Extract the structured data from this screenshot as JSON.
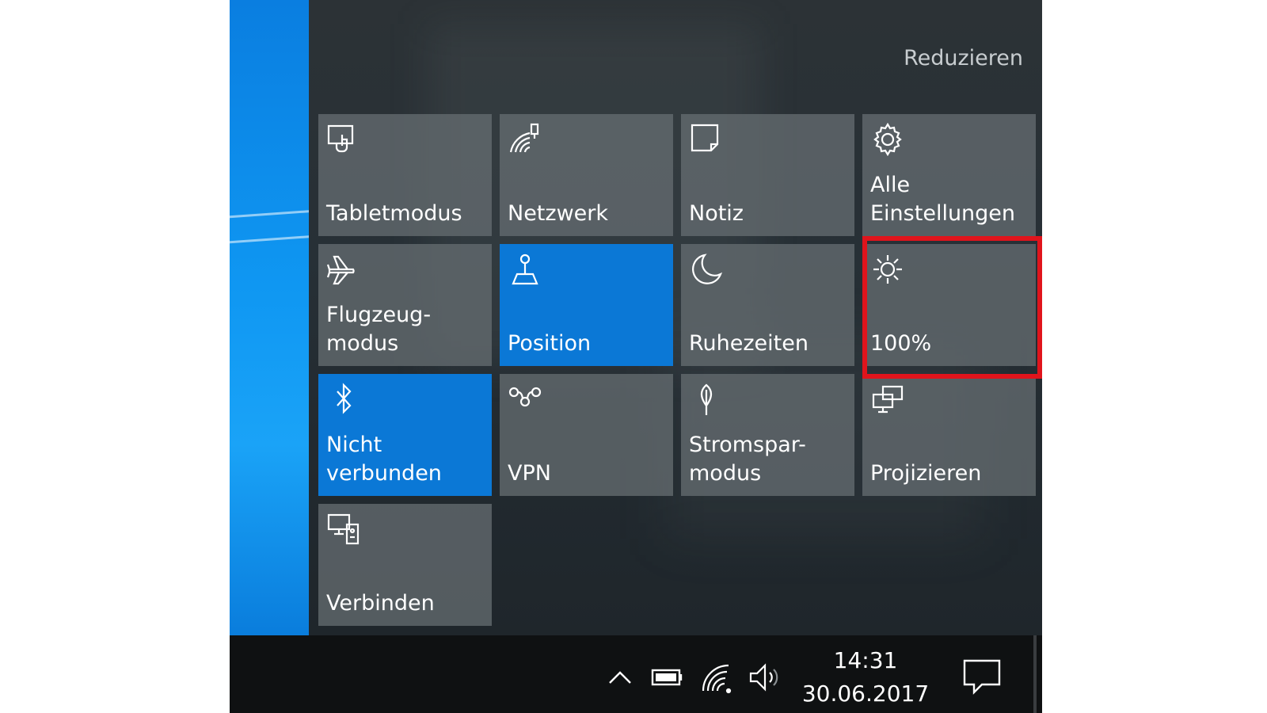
{
  "panel": {
    "collapse_label": "Reduzieren"
  },
  "tiles": [
    {
      "label": "Tabletmodus",
      "icon": "tablet-mode-icon",
      "active": false
    },
    {
      "label": "Netzwerk",
      "icon": "network-icon",
      "active": false
    },
    {
      "label": "Notiz",
      "icon": "note-icon",
      "active": false
    },
    {
      "label": "Alle\nEinstellungen",
      "icon": "gear-icon",
      "active": false
    },
    {
      "label": "Flugzeug-\nmodus",
      "icon": "airplane-icon",
      "active": false
    },
    {
      "label": "Position",
      "icon": "location-icon",
      "active": true
    },
    {
      "label": "Ruhezeiten",
      "icon": "moon-icon",
      "active": false
    },
    {
      "label": "100%",
      "icon": "brightness-icon",
      "active": false
    },
    {
      "label": "Nicht\nverbunden",
      "icon": "bluetooth-icon",
      "active": true
    },
    {
      "label": "VPN",
      "icon": "vpn-icon",
      "active": false
    },
    {
      "label": "Stromspar-\nmodus",
      "icon": "battery-saver-icon",
      "active": false
    },
    {
      "label": "Projizieren",
      "icon": "project-icon",
      "active": false
    },
    {
      "label": "Verbinden",
      "icon": "connect-icon",
      "active": false
    }
  ],
  "taskbar": {
    "time": "14:31",
    "date": "30.06.2017",
    "tray_icons": [
      "chevron-up-icon",
      "battery-icon",
      "wifi-icon",
      "volume-icon"
    ],
    "notification_icon": "action-center-icon"
  },
  "colors": {
    "accent": "#0b78d6",
    "tile": "#646c70",
    "highlight": "#e0141c",
    "taskbar": "#0f1112"
  }
}
